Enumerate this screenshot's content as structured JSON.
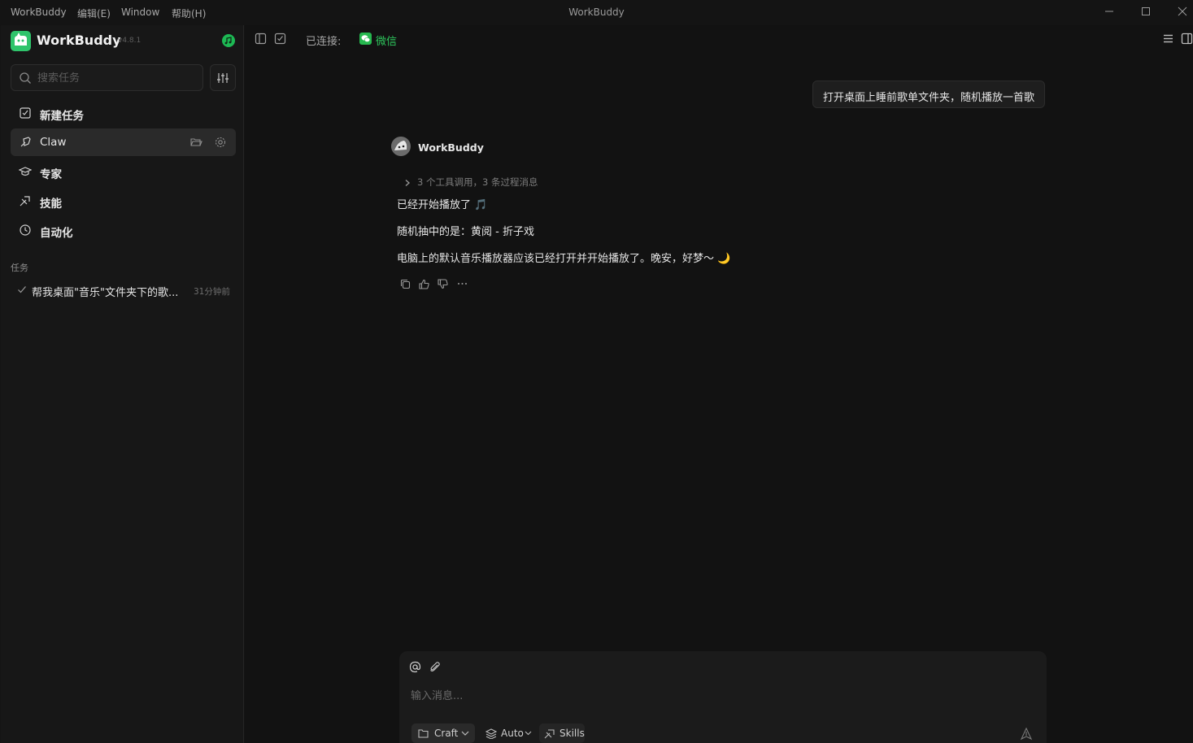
{
  "menu": {
    "app": "WorkBuddy",
    "edit": "编辑(E)",
    "window": "Window",
    "help": "帮助(H)"
  },
  "window_title": "WorkBuddy",
  "sidebar": {
    "app_name": "WorkBuddy",
    "version": "v4.8.1",
    "search_placeholder": "搜索任务",
    "nav": [
      {
        "label": "新建任务",
        "icon": "new-task-icon"
      },
      {
        "label": "Claw",
        "icon": "claw-icon"
      },
      {
        "label": "专家",
        "icon": "expert-icon"
      },
      {
        "label": "技能",
        "icon": "skills-icon"
      },
      {
        "label": "自动化",
        "icon": "clock-icon"
      }
    ],
    "section_tasks": "任务",
    "tasks": [
      {
        "title": "帮我桌面\"音乐\"文件夹下的歌...",
        "time": "31分钟前"
      }
    ]
  },
  "toolbar": {
    "connected_label": "已连接:",
    "channel": "微信"
  },
  "chat": {
    "user_message": "打开桌面上睡前歌单文件夹，随机播放一首歌",
    "bot_name": "WorkBuddy",
    "tool_summary": "3  个工具调用，3  条过程消息",
    "lines": [
      "已经开始播放了 🎵",
      "随机抽中的是：黄阅 - 折子戏",
      "电脑上的默认音乐播放器应该已经打开并开始播放了。晚安，好梦～ 🌙"
    ]
  },
  "composer": {
    "placeholder": "输入消息...",
    "mode": "Craft",
    "model": "Auto",
    "skills": "Skills"
  },
  "colors": {
    "accent_green": "#2fc46b",
    "wechat_green": "#2ec55c",
    "background": "#121212"
  }
}
